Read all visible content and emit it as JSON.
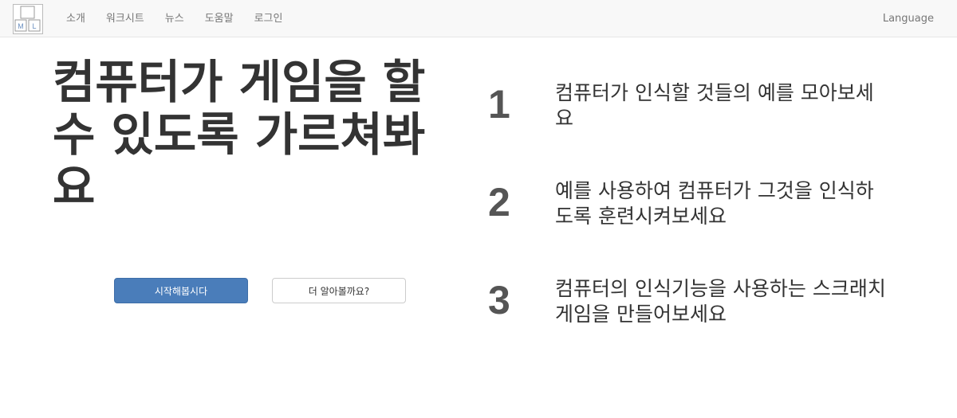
{
  "nav": {
    "logo_letters": [
      "M",
      "L"
    ],
    "links": [
      "소개",
      "워크시트",
      "뉴스",
      "도움말",
      "로그인"
    ],
    "language": "Language"
  },
  "hero": {
    "title": "컴퓨터가 게임을 할 수 있도록 가르쳐봐요",
    "primary_button": "시작해봅시다",
    "secondary_button": "더 알아볼까요?"
  },
  "steps": [
    {
      "number": "1",
      "text": "컴퓨터가 인식할 것들의 예를 모아보세\n요"
    },
    {
      "number": "2",
      "text": "예를 사용하여 컴퓨터가 그것을 인식하\n도록 훈련시켜보세요"
    },
    {
      "number": "3",
      "text": "컴퓨터의 인식기능을 사용하는 스크래치\n게임을 만들어보세요"
    }
  ],
  "colors": {
    "primary": "#4a7dba",
    "navbar_bg": "#f8f8f8",
    "title_text": "#333333",
    "step_number": "#555555"
  }
}
